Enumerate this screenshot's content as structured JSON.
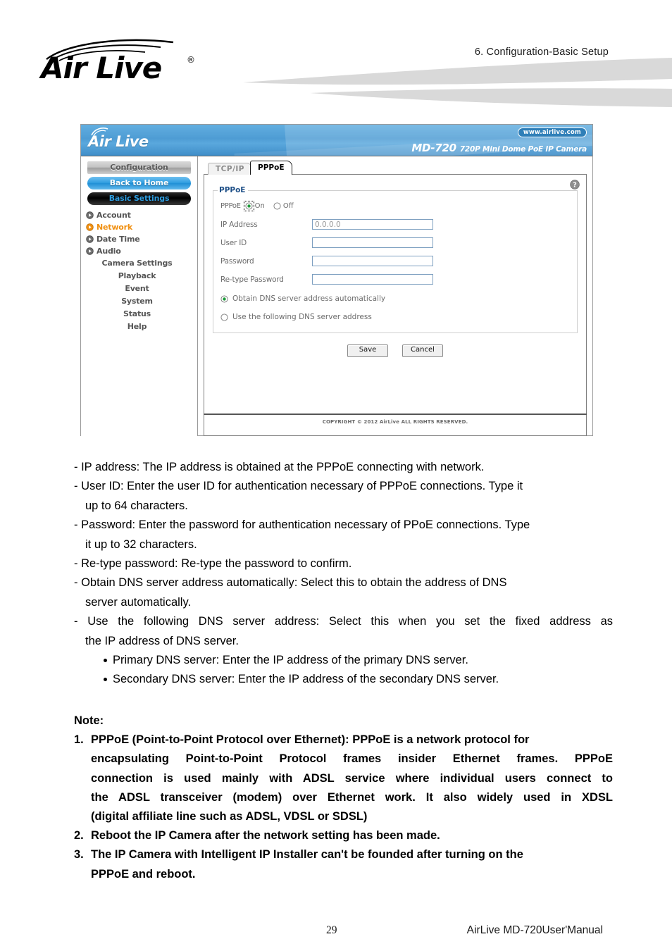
{
  "page": {
    "header_title": "6.  Configuration-Basic  Setup",
    "brand": "Air Live",
    "brand_registered": "®",
    "page_number": "29",
    "manual_name": "AirLive MD-720User'Manual"
  },
  "camera_ui": {
    "topbar": {
      "logo": "Air Live",
      "logo_mark": "wifi-arc-icon",
      "url_badge": "www.airlive.com",
      "model": "MD-720",
      "model_desc": "720P Mini Dome PoE IP Camera"
    },
    "sidebar": {
      "buttons": [
        {
          "label": "Configuration",
          "style": "gray"
        },
        {
          "label": "Back to Home",
          "style": "blue"
        },
        {
          "label": "Basic Settings",
          "style": "black"
        }
      ],
      "links": [
        {
          "label": "Account",
          "active": false
        },
        {
          "label": "Network",
          "active": true
        },
        {
          "label": "Date Time",
          "active": false
        },
        {
          "label": "Audio",
          "active": false
        }
      ],
      "sub_items": [
        "Camera Settings",
        "Playback",
        "Event",
        "System",
        "Status",
        "Help"
      ]
    },
    "tabs": [
      {
        "label": "TCP/IP",
        "active": false
      },
      {
        "label": "PPPoE",
        "active": true
      }
    ],
    "panel": {
      "help_icon": "question-mark-icon",
      "legend": "PPPoE",
      "toggle": {
        "label": "PPPoE",
        "options": [
          "On",
          "Off"
        ],
        "selected": "On"
      },
      "fields": [
        {
          "label": "IP Address",
          "value": "0.0.0.0",
          "placeholder": "0.0.0.0",
          "readonly": true
        },
        {
          "label": "User ID",
          "value": "",
          "placeholder": ""
        },
        {
          "label": "Password",
          "value": "",
          "placeholder": ""
        },
        {
          "label": "Re-type Password",
          "value": "",
          "placeholder": ""
        }
      ],
      "dns_options": [
        {
          "label": "Obtain DNS server address automatically",
          "selected": true
        },
        {
          "label": "Use the following DNS server address",
          "selected": false
        }
      ],
      "buttons": [
        {
          "label": "Save"
        },
        {
          "label": "Cancel"
        }
      ]
    },
    "footer_copyright": "COPYRIGHT © 2012 AirLive ALL RIGHTS RESERVED."
  },
  "body_text": {
    "line_ip": "- IP address: The IP address is obtained at the PPPoE connecting with network.",
    "line_userid_1": "- User ID: Enter the user ID for authentication necessary of PPPoE connections. Type it",
    "line_userid_2": "up to 64 characters.",
    "line_password_1": "- Password: Enter the password for authentication necessary of PPoE connections. Type",
    "line_password_2": "it up to 32 characters.",
    "line_retype": "- Re-type password: Re-type the password to confirm.",
    "line_obtain_1": "- Obtain DNS server address automatically: Select this to obtain the address of DNS",
    "line_obtain_2": "server automatically.",
    "line_usedns_1": "- Use the following DNS server address: Select this when you set the fixed address as",
    "line_usedns_2": "the IP address of DNS server.",
    "sub_primary": "Primary DNS server: Enter the IP address of the primary DNS server.",
    "sub_secondary": "Secondary DNS server: Enter the IP address of the secondary DNS server."
  },
  "note": {
    "heading": "Note:",
    "items": [
      {
        "number": "1.",
        "lines": [
          "PPPoE (Point-to-Point Protocol over Ethernet): PPPoE is a network protocol for",
          "encapsulating Point-to-Point Protocol frames insider Ethernet frames. PPPoE",
          "connection is used mainly with ADSL service where individual users connect to",
          "the ADSL transceiver (modem) over Ethernet work. It also widely used in XDSL",
          "(digital affiliate line such as ADSL, VDSL or SDSL)"
        ]
      },
      {
        "number": "2.",
        "lines": [
          "Reboot the IP Camera after the network setting has been made."
        ]
      },
      {
        "number": "3.",
        "lines": [
          "The IP Camera with Intelligent IP Installer can't be founded after turning on the",
          "PPPoE and reboot."
        ]
      }
    ]
  },
  "colors": {
    "brand_blue": "#4e9cd4",
    "active_orange": "#f09012",
    "legend_blue": "#1e4f87",
    "radio_green": "#1f9a3a",
    "swoosh_gray": "#d9d9d9"
  }
}
